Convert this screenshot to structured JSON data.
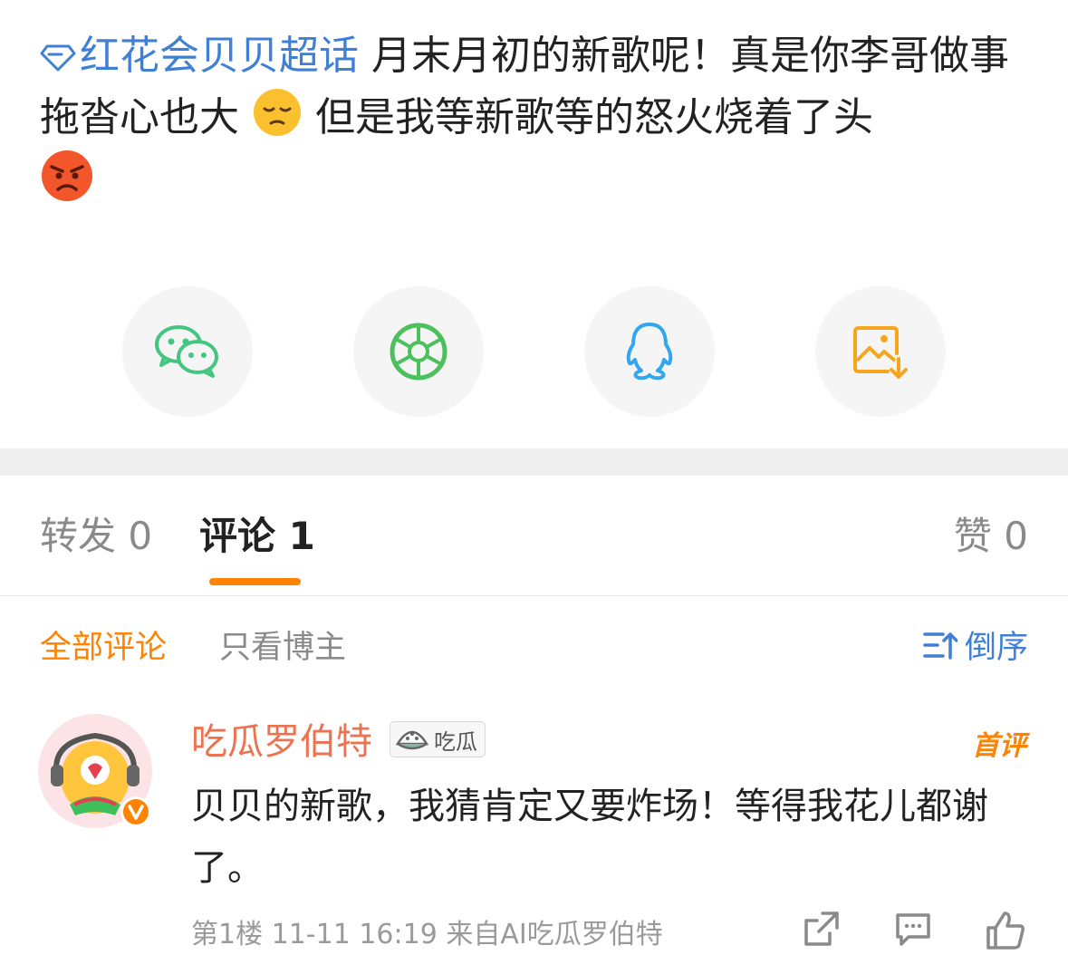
{
  "post": {
    "topic_name": "红花会贝贝超话",
    "text_part1": "月末月初的新歌呢！真是你李哥做事拖沓心也大",
    "emoji1": "pensive-face",
    "text_part2": "但是我等新歌等的怒火烧着了头",
    "emoji2": "angry-face"
  },
  "share": {
    "buttons": [
      {
        "icon": "wechat-icon",
        "color": "#45c680"
      },
      {
        "icon": "moments-icon",
        "color": "#4cc05c"
      },
      {
        "icon": "qq-icon",
        "color": "#33a6f0"
      },
      {
        "icon": "save-image-icon",
        "color": "#f7a51c"
      }
    ]
  },
  "tabs": {
    "repost": "转发 0",
    "comments": "评论 1",
    "likes": "赞 0"
  },
  "filters": {
    "all": "全部评论",
    "owner_only": "只看博主",
    "sort": "倒序"
  },
  "comment": {
    "user": "吃瓜罗伯特",
    "badge": "吃瓜",
    "first_tag": "首评",
    "text": "贝贝的新歌，我猜肯定又要炸场！等得我花儿都谢了。",
    "meta": "第1楼 11-11 16:19 来自AI吃瓜罗伯特"
  },
  "colors": {
    "accent_orange": "#ff8200",
    "link_blue": "#3f7fd4",
    "username": "#eb7350"
  }
}
